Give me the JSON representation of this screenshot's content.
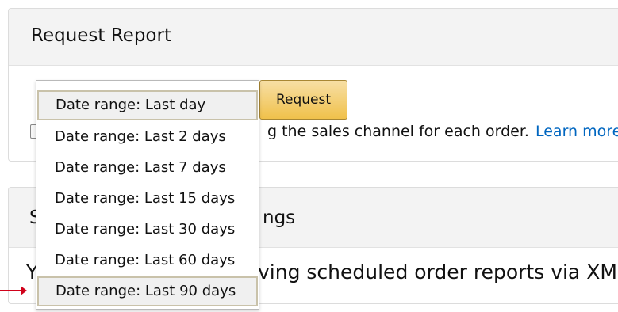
{
  "request_panel": {
    "title": "Request Report",
    "request_button": "Request",
    "option_text_visible": "g the sales channel for each order.",
    "learn_more": "Learn more"
  },
  "scheduled_panel": {
    "title_visible": "ngs",
    "body_visible": "ving scheduled order reports via XML",
    "left_glyph_header": "S",
    "left_glyph_body": "Y"
  },
  "date_range": {
    "selected": "Date range: Last day",
    "options": [
      "Date range: Last day",
      "Date range: Last 2 days",
      "Date range: Last 7 days",
      "Date range: Last 15 days",
      "Date range: Last 30 days",
      "Date range: Last 60 days",
      "Date range: Last 90 days"
    ],
    "highlighted": "Date range: Last 90 days"
  },
  "colors": {
    "button_top": "#f7dfa5",
    "button_bottom": "#f0c14b",
    "link": "#0066c0",
    "arrow": "#d0021b",
    "panel_header": "#f3f3f3"
  },
  "icons": {
    "checkbox": "checkbox-icon",
    "annotation_arrow": "red-arrow-icon"
  }
}
